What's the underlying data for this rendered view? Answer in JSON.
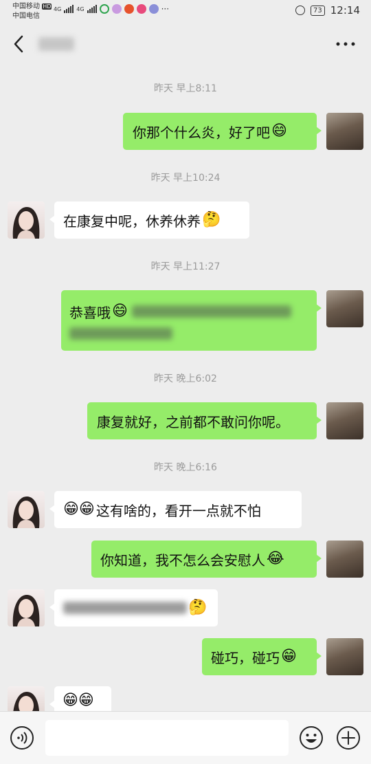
{
  "status_bar": {
    "carrier_1": "中国移动",
    "carrier_1_badge": "HD",
    "carrier_2": "中国电信",
    "network_1": "4G",
    "network_2": "4G",
    "battery": "73",
    "time": "12:14"
  },
  "header": {
    "back_icon": "chevron-left-icon",
    "more_icon": "more-dots-icon"
  },
  "chat": {
    "timestamps": [
      "昨天 早上8:11",
      "昨天 早上10:24",
      "昨天 早上11:27",
      "昨天 晚上6:02",
      "昨天 晚上6:16"
    ],
    "messages": [
      {
        "side": "out",
        "text": "你那个什么炎，好了吧",
        "emoji": "😄"
      },
      {
        "side": "in",
        "text": "在康复中呢，休养休养",
        "emoji": "🤔"
      },
      {
        "side": "out",
        "text": "恭喜哦",
        "emoji": "😄"
      },
      {
        "side": "out",
        "text": "康复就好，之前都不敢问你呢。"
      },
      {
        "side": "in",
        "prefix_emoji": "😁😁",
        "text": "这有啥的，看开一点就不怕"
      },
      {
        "side": "out",
        "text": "你知道，我不怎么会安慰人",
        "emoji": "😂"
      },
      {
        "side": "in",
        "emoji": "🤔"
      },
      {
        "side": "out",
        "text": "碰巧，碰巧",
        "emoji": "😁"
      },
      {
        "side": "in",
        "prefix_emoji": "😁😁"
      }
    ]
  },
  "input_bar": {
    "voice_icon": "voice-icon",
    "emoji_icon": "emoji-icon",
    "add_icon": "add-icon",
    "placeholder": ""
  },
  "colors": {
    "background": "#ededed",
    "outgoing_bubble": "#95ec69",
    "incoming_bubble": "#ffffff",
    "timestamp_text": "#9a9a9a"
  }
}
